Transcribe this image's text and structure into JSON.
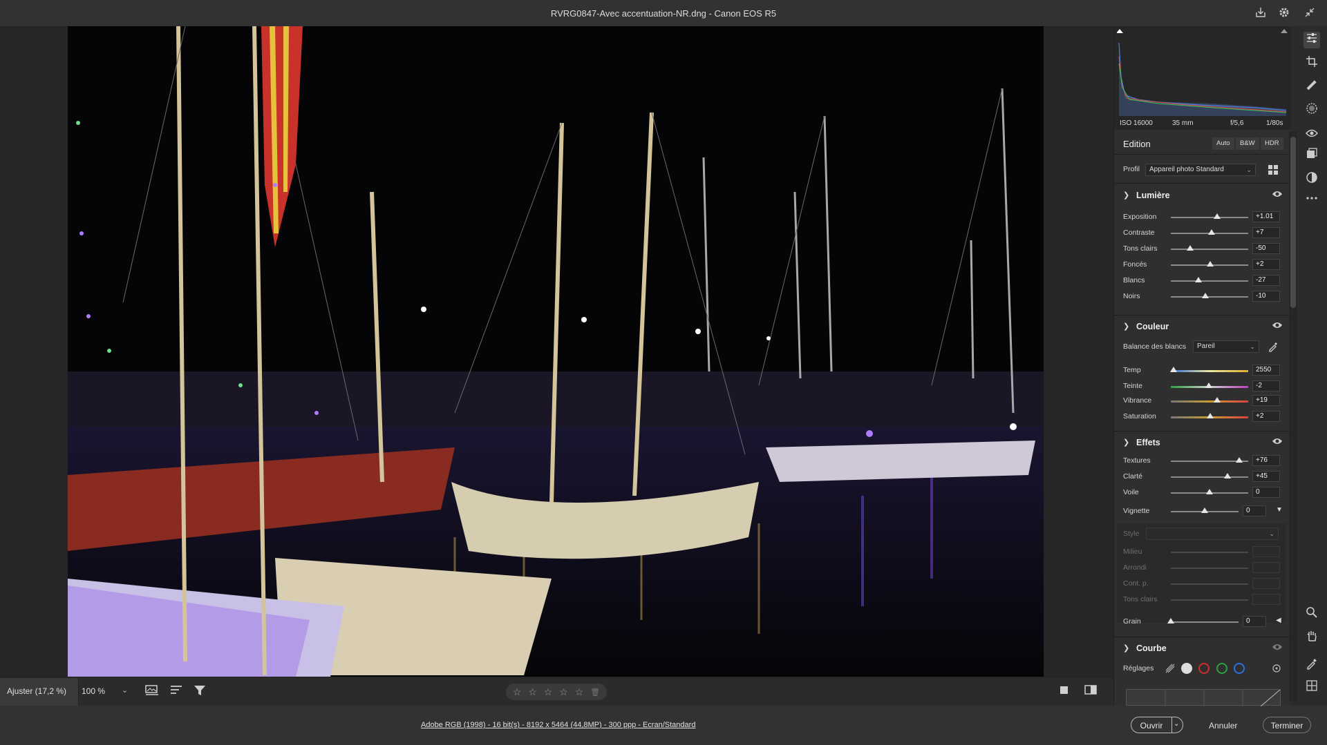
{
  "titlebar": {
    "title": "RVRG0847-Avec accentuation-NR.dng  -  Canon EOS R5"
  },
  "viewbar": {
    "zoom_fit": "Ajuster (17,2 %)",
    "zoom_value": "100 %",
    "stars": [
      "☆",
      "☆",
      "☆",
      "☆",
      "☆"
    ],
    "trash": "🗑"
  },
  "footer": {
    "info": "Adobe RGB (1998) - 16 bit(s) - 8192 x 5464 (44,8MP) - 300 ppp - Ecran/Standard",
    "open": "Ouvrir",
    "cancel": "Annuler",
    "done": "Terminer"
  },
  "exif": {
    "iso": "ISO 16000",
    "focal": "35 mm",
    "aperture": "f/5,6",
    "shutter": "1/80s"
  },
  "edit": {
    "title": "Edition",
    "buttons": [
      "Auto",
      "B&W",
      "HDR"
    ],
    "profile_label": "Profil",
    "profile_value": "Appareil photo Standard"
  },
  "light": {
    "title": "Lumière",
    "sliders": [
      {
        "label": "Exposition",
        "value": "+1.01",
        "pos": 0.6
      },
      {
        "label": "Contraste",
        "value": "+7",
        "pos": 0.53
      },
      {
        "label": "Tons clairs",
        "value": "-50",
        "pos": 0.25
      },
      {
        "label": "Foncés",
        "value": "+2",
        "pos": 0.51
      },
      {
        "label": "Blancs",
        "value": "-27",
        "pos": 0.36
      },
      {
        "label": "Noirs",
        "value": "-10",
        "pos": 0.45
      }
    ]
  },
  "color": {
    "title": "Couleur",
    "wb_label": "Balance des blancs",
    "wb_value": "Pareil",
    "sliders": [
      {
        "label": "Temp",
        "value": "2550",
        "pos": 0.04
      },
      {
        "label": "Teinte",
        "value": "-2",
        "pos": 0.49
      },
      {
        "label": "Vibrance",
        "value": "+19",
        "pos": 0.6
      },
      {
        "label": "Saturation",
        "value": "+2",
        "pos": 0.51
      }
    ]
  },
  "effects": {
    "title": "Effets",
    "sliders": [
      {
        "label": "Textures",
        "value": "+76",
        "pos": 0.88
      },
      {
        "label": "Clarté",
        "value": "+45",
        "pos": 0.73
      },
      {
        "label": "Voile",
        "value": "0",
        "pos": 0.5
      }
    ],
    "vignette": {
      "label": "Vignette",
      "value": "0",
      "pos": 0.5
    },
    "style_label": "Style",
    "sub": [
      "Milieu",
      "Arrondi",
      "Cont. p.",
      "Tons clairs"
    ],
    "grain": {
      "label": "Grain",
      "value": "0",
      "pos": 0.0
    }
  },
  "curve": {
    "title": "Courbe",
    "settings_label": "Réglages"
  },
  "colors": {
    "accent": "#e6e6e6",
    "red": "#d22d2d",
    "green": "#2f9e3f",
    "blue": "#2b6fe0"
  },
  "icons": {
    "titlebar": [
      "save-icon",
      "gear-icon",
      "collapse-icon"
    ],
    "tools": [
      "edit-sliders-icon",
      "crop-icon",
      "heal-icon",
      "mask-icon",
      "redeye-icon",
      "snapshot-icon",
      "preset-icon",
      "more-icon",
      "zoom-icon",
      "hand-icon",
      "color-sampler-icon",
      "grid-icon"
    ]
  }
}
